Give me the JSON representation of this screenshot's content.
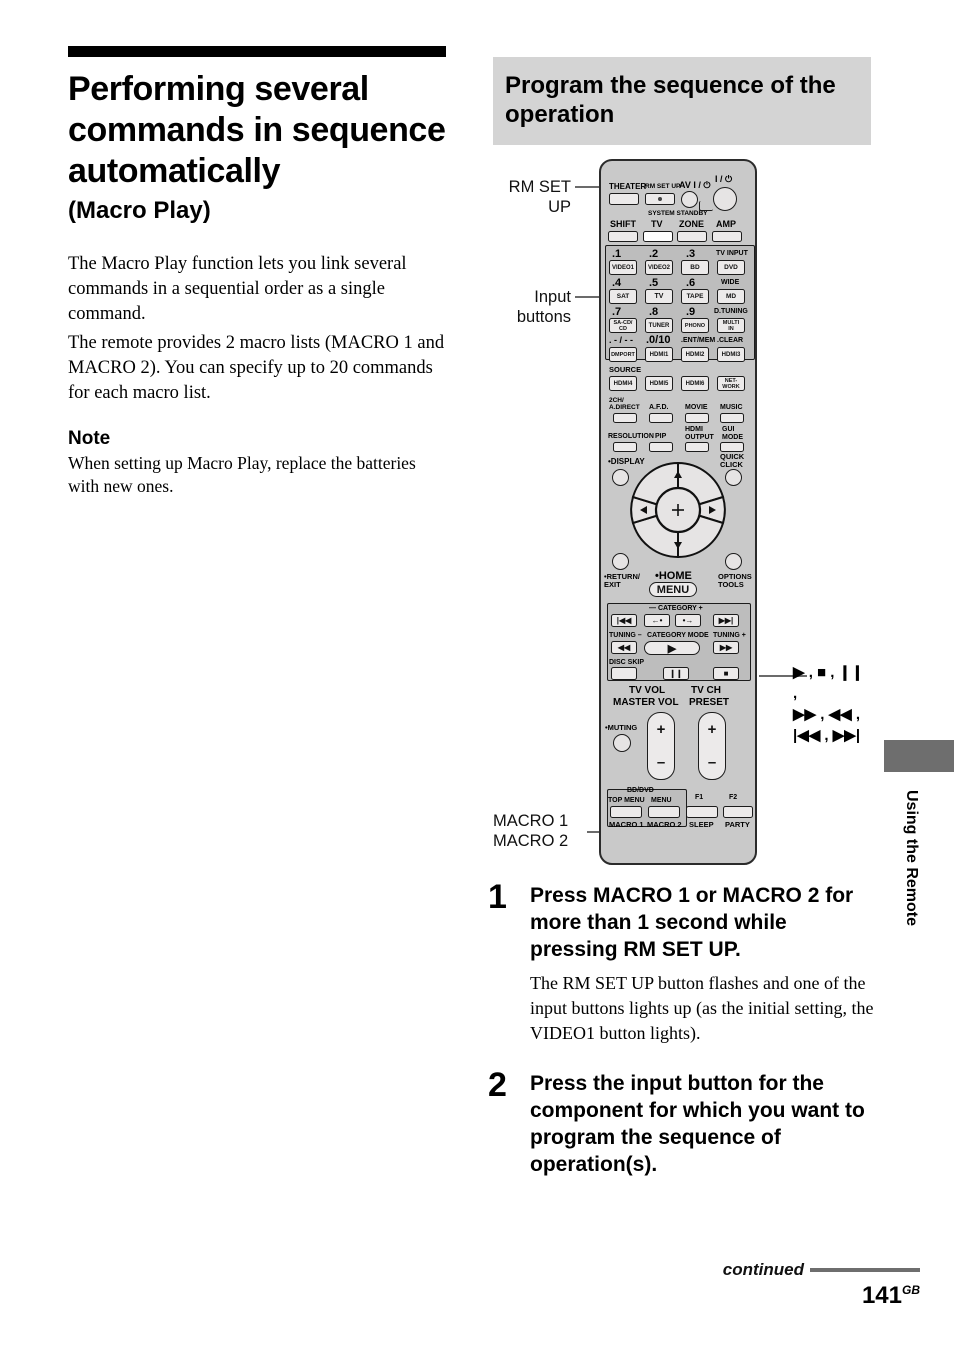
{
  "left": {
    "title": "Performing several commands in sequence automatically",
    "subtitle": "(Macro Play)",
    "para1": "The Macro Play function lets you link several commands in a sequential order as a single command.",
    "para2": "The remote provides 2 macro lists (MACRO 1 and MACRO 2). You can specify up to 20 commands for each macro list.",
    "note_head": "Note",
    "note_body": "When setting up Macro Play, replace the batteries with new ones."
  },
  "right": {
    "section_title": "Program the sequence of the operation"
  },
  "callouts": {
    "rm_set_up": "RM SET\nUP",
    "rm_set_up_l1": "RM SET",
    "rm_set_up_l2": "UP",
    "input_buttons_l1": "Input",
    "input_buttons_l2": "buttons",
    "macro1": "MACRO 1",
    "macro2": "MACRO 2",
    "transport_l1": "▶ , ■ , ❙❙ ,",
    "transport_l2": "▶▶ , ◀◀ ,",
    "transport_l3": "|◀◀ , ▶▶|"
  },
  "remote": {
    "top_row": {
      "theater": "THEATER",
      "rm_set_up": "RM SET UP",
      "av_power": "AV I / ⏻",
      "main_power": "I / ⏻",
      "system_standby": "SYSTEM STANDBY"
    },
    "mode_row": [
      "SHIFT",
      "TV",
      "ZONE",
      "AMP"
    ],
    "numbers": {
      "r1": [
        ".1",
        ".2",
        ".3",
        "TV INPUT"
      ],
      "r2": [
        ".4",
        ".5",
        ".6",
        "WIDE"
      ],
      "r3": [
        ".7",
        ".8",
        ".9",
        "D.TUNING"
      ],
      "r4": [
        ". - / - -",
        ".0/10",
        ".ENT/MEM",
        ".CLEAR"
      ],
      "r5": [
        "SOURCE",
        "",
        "",
        ""
      ]
    },
    "inputs": {
      "r1": [
        "VIDEO1",
        "VIDEO2",
        "BD",
        "DVD"
      ],
      "r2": [
        "SAT",
        "TV",
        "TAPE",
        "MD"
      ],
      "r3": [
        "SA-CD/\nCD",
        "TUNER",
        "PHONO",
        "MULTI\nIN"
      ],
      "r4": [
        "DMPORT",
        "HDMI1",
        "HDMI2",
        "HDMI3"
      ],
      "r5": [
        "HDMI4",
        "HDMI5",
        "HDMI6",
        "NET-\nWORK"
      ]
    },
    "sound_labels_r1": [
      "2CH/\nA.DIRECT",
      "A.F.D.",
      "MOVIE",
      "MUSIC"
    ],
    "sound_labels_r2": [
      "RESOLUTION",
      "PIP",
      "HDMI\nOUTPUT",
      "GUI\nMODE"
    ],
    "display_label": "•DISPLAY",
    "quick_click_label": "QUICK\nCLICK",
    "nav": {
      "return_exit": "•RETURN/\nEXIT",
      "home": "•HOME",
      "menu": "MENU",
      "options_tools": "OPTIONS\nTOOLS"
    },
    "transport": {
      "category": "— CATEGORY +",
      "category_mode": "CATEGORY MODE",
      "tuning_minus": "TUNING –",
      "tuning_plus": "TUNING +",
      "disc_skip": "DISC SKIP",
      "prev": "|◀◀",
      "next": "▶▶|",
      "cat_left": "←•",
      "cat_right": "•→",
      "rew": "◀◀",
      "ff": "▶▶",
      "play": "▶",
      "pause": "❙❙",
      "stop": "■"
    },
    "volume": {
      "tv_vol": "TV VOL",
      "master_vol": "MASTER VOL",
      "tv_ch": "TV CH",
      "preset": "PRESET",
      "muting": "•MUTING",
      "plus": "+",
      "minus": "–"
    },
    "bottom": {
      "bd_dvd": "BD/DVD",
      "top_menu": "TOP MENU",
      "menu": "MENU",
      "f1": "F1",
      "f2": "F2",
      "macro1": "MACRO 1",
      "macro2": "MACRO 2",
      "sleep": "SLEEP",
      "party": "PARTY"
    }
  },
  "steps": [
    {
      "num": "1",
      "head": "Press MACRO 1 or MACRO 2 for more than 1 second while pressing RM SET UP.",
      "text": "The RM SET UP button flashes and one of the input buttons lights up (as the initial setting, the VIDEO1 button lights)."
    },
    {
      "num": "2",
      "head": "Press the input button for the component for which you want to program the sequence of operation(s).",
      "text": ""
    }
  ],
  "side_tab": "Using the Remote",
  "footer": {
    "continued": "continued",
    "page": "141",
    "page_sup": "GB"
  },
  "colors": {
    "band": "#d4d4d4",
    "remote_body": "#c9c9c9",
    "button": "#eceaea",
    "rule": "#6e6e6e"
  }
}
